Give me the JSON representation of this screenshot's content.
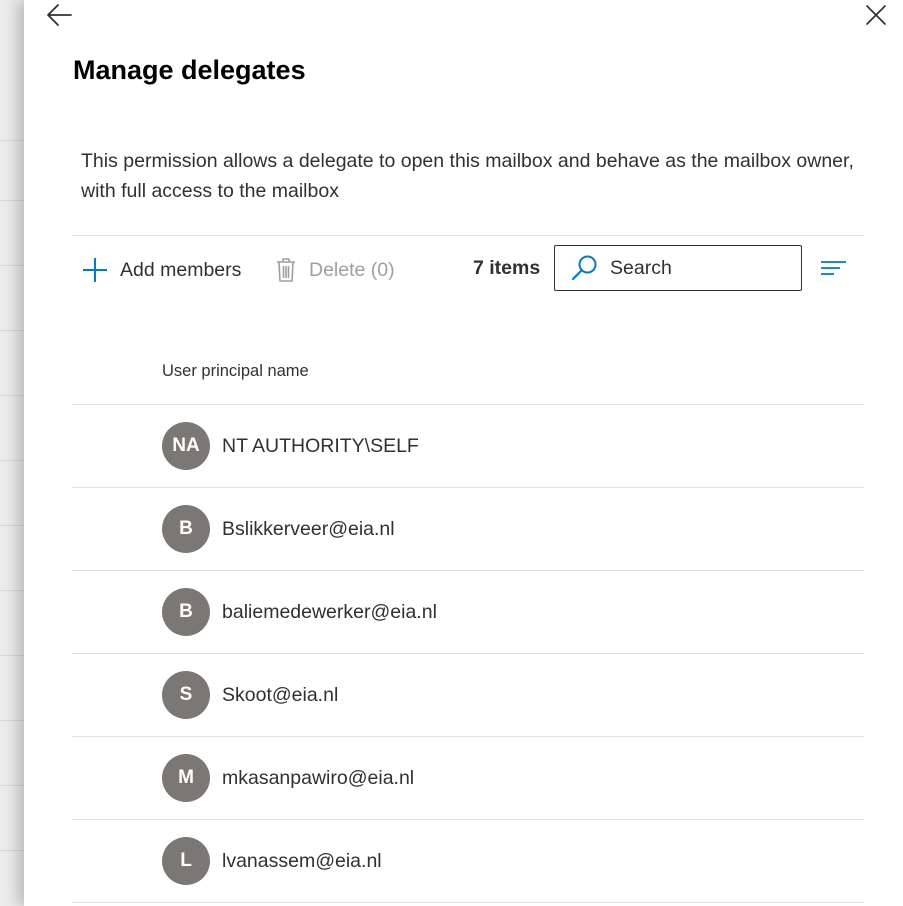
{
  "panel": {
    "title": "Manage delegates",
    "description": "This permission allows a delegate to open this mailbox and behave as the mailbox owner, with full access to the mailbox"
  },
  "toolbar": {
    "add_label": "Add members",
    "delete_label": "Delete (0)",
    "item_count": "7 items",
    "search_placeholder": "Search"
  },
  "table": {
    "column_header": "User principal name",
    "rows": [
      {
        "initials": "NA",
        "upn": "NT AUTHORITY\\SELF"
      },
      {
        "initials": "B",
        "upn": "Bslikkerveer@eia.nl"
      },
      {
        "initials": "B",
        "upn": "baliemedewerker@eia.nl"
      },
      {
        "initials": "S",
        "upn": "Skoot@eia.nl"
      },
      {
        "initials": "M",
        "upn": "mkasanpawiro@eia.nl"
      },
      {
        "initials": "L",
        "upn": "lvanassem@eia.nl"
      }
    ]
  },
  "colors": {
    "accent": "#0078d4",
    "avatar_bg": "#7a7774",
    "disabled_text": "#a19f9d"
  },
  "icons": {
    "back": "arrow-left-icon",
    "close": "close-icon",
    "add": "plus-icon",
    "delete": "trash-icon",
    "search": "search-icon",
    "filter": "filter-icon"
  }
}
